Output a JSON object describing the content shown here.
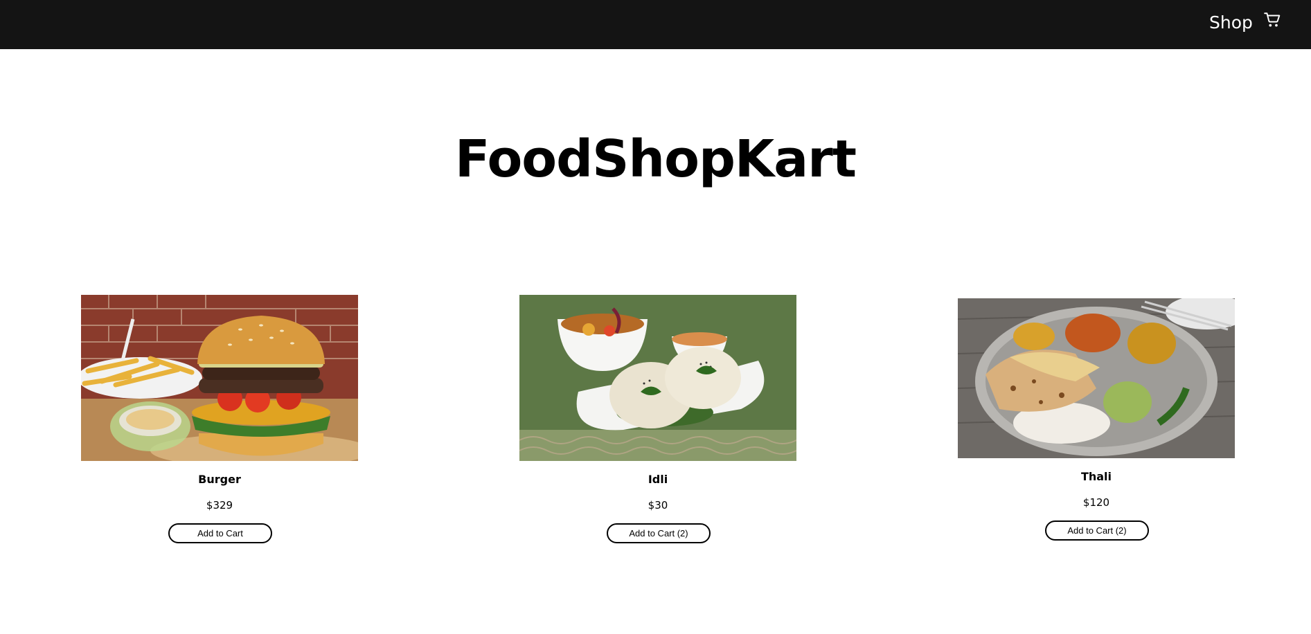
{
  "nav": {
    "shop_label": "Shop",
    "cart_icon": "cart-icon"
  },
  "hero": {
    "title": "FoodShopKart"
  },
  "products": [
    {
      "name": "Burger",
      "price": "$329",
      "button_label": "Add to Cart",
      "image_icon": "burger-image"
    },
    {
      "name": "Idli",
      "price": "$30",
      "button_label": "Add to Cart (2)",
      "image_icon": "idli-image"
    },
    {
      "name": "Thali",
      "price": "$120",
      "button_label": "Add to Cart (2)",
      "image_icon": "thali-image"
    }
  ],
  "colors": {
    "navbar_bg": "#141414",
    "nav_text": "#ffffff",
    "page_bg": "#ffffff",
    "button_border": "#000000"
  }
}
